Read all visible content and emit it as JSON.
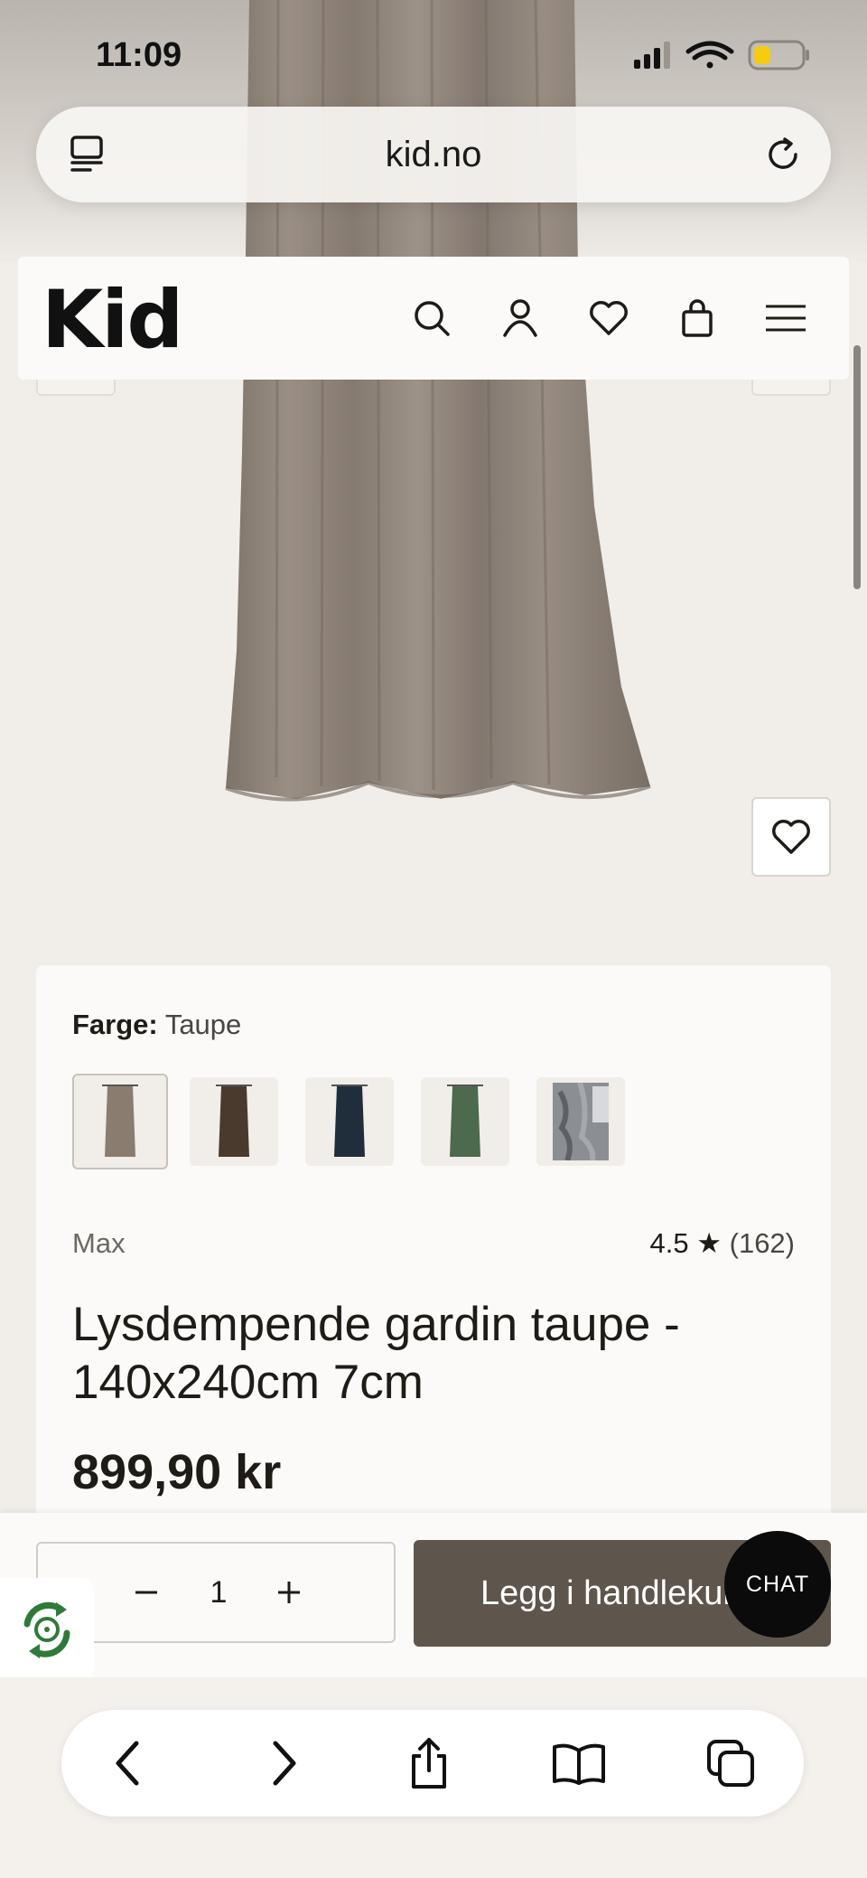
{
  "status_bar": {
    "time": "11:09"
  },
  "browser": {
    "url": "kid.no"
  },
  "site": {
    "logo": "Kid"
  },
  "product": {
    "color_label": "Farge:",
    "color_value": "Taupe",
    "swatches": [
      {
        "name": "taupe",
        "color": "#8a7c6e"
      },
      {
        "name": "brown",
        "color": "#4a3a2e"
      },
      {
        "name": "navy",
        "color": "#1f2e3a"
      },
      {
        "name": "green",
        "color": "#4b6a4e"
      },
      {
        "name": "grey",
        "color": "#7a7e84"
      }
    ],
    "brand": "Max",
    "rating": "4.5 ★",
    "review_count": "(162)",
    "title": "Lysdempende gardin taupe - 140x240cm 7cm",
    "price": "899,90 kr"
  },
  "buy_bar": {
    "quantity": "1",
    "add_to_cart_label": "Legg i handlekurv",
    "chat_label": "CHAT"
  },
  "colors": {
    "curtain": "#8c8177",
    "button_dark": "#5e554c",
    "page_bg": "#f1ede8"
  }
}
